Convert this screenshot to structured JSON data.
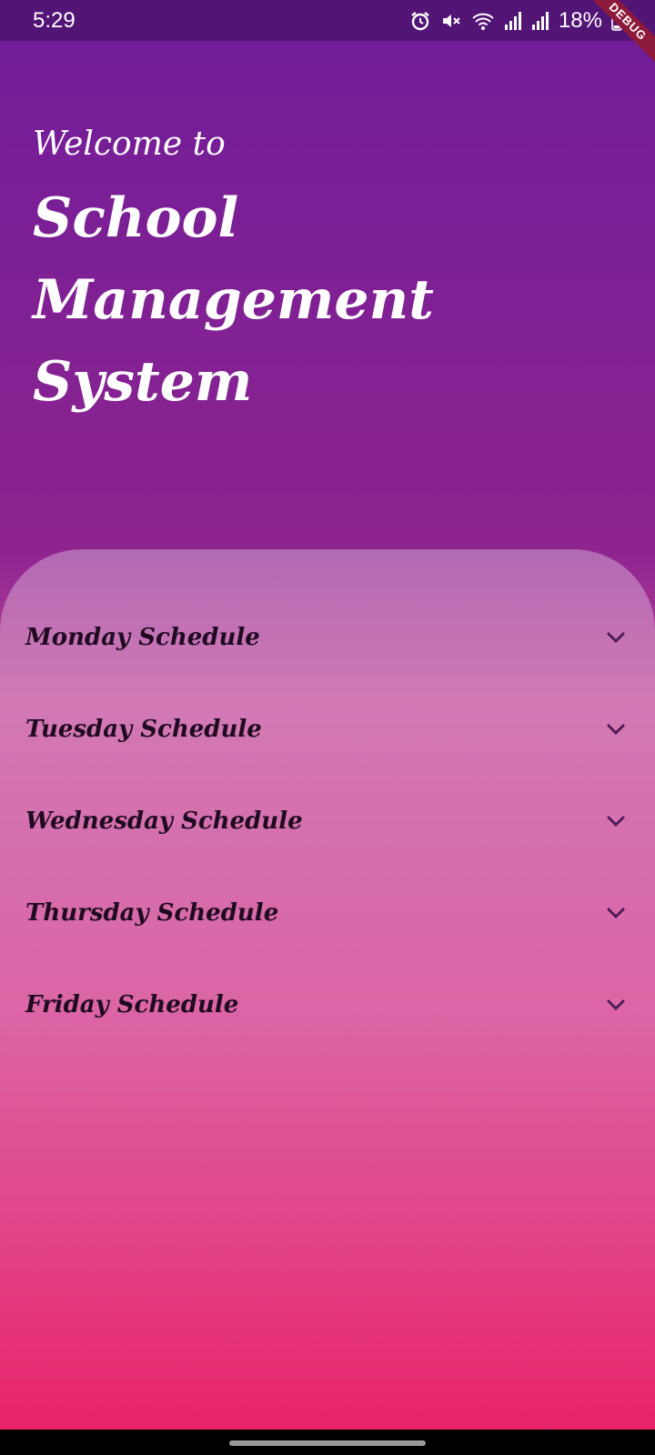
{
  "status_bar": {
    "time": "5:29",
    "battery": "18%",
    "icons": [
      "alarm-icon",
      "mute-icon",
      "wifi-icon",
      "signal-icon",
      "signal-icon",
      "battery-icon"
    ]
  },
  "debug_banner": "DEBUG",
  "header": {
    "welcome": "Welcome to",
    "title": "School Management System"
  },
  "schedules": [
    {
      "label": "Monday Schedule"
    },
    {
      "label": "Tuesday Schedule"
    },
    {
      "label": "Wednesday Schedule"
    },
    {
      "label": "Thursday Schedule"
    },
    {
      "label": "Friday Schedule"
    }
  ],
  "colors": {
    "gradient_top": "#6f1c99",
    "gradient_bottom": "#ea2066",
    "status_bar": "#521475",
    "label_text": "#1f0a22"
  }
}
